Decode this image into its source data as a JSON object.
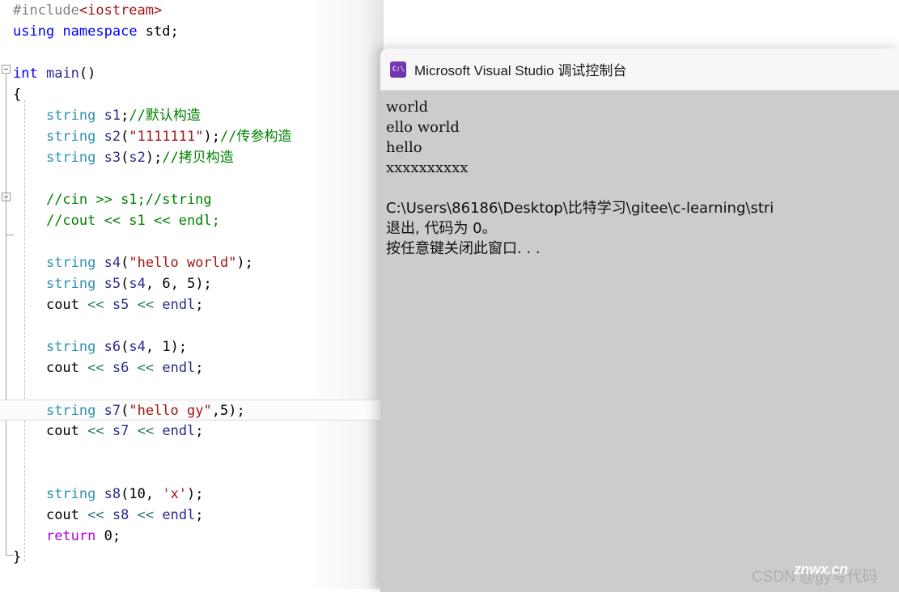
{
  "editor": {
    "name": "code-editor",
    "current_line_index": 19,
    "lines": [
      {
        "indent": 0,
        "tokens": [
          {
            "t": "pre",
            "v": "#include"
          },
          {
            "t": "inc",
            "v": "<iostream>"
          }
        ]
      },
      {
        "indent": 0,
        "tokens": [
          {
            "t": "key",
            "v": "using"
          },
          {
            "t": "plain",
            "v": " "
          },
          {
            "t": "key",
            "v": "namespace"
          },
          {
            "t": "plain",
            "v": " std;"
          }
        ]
      },
      {
        "indent": 0,
        "tokens": []
      },
      {
        "indent": 0,
        "tokens": [
          {
            "t": "key",
            "v": "int"
          },
          {
            "t": "plain",
            "v": " "
          },
          {
            "t": "ident",
            "v": "main"
          },
          {
            "t": "plain",
            "v": "()"
          }
        ]
      },
      {
        "indent": 0,
        "tokens": [
          {
            "t": "brace",
            "v": "{"
          }
        ]
      },
      {
        "indent": 1,
        "tokens": [
          {
            "t": "type",
            "v": "string"
          },
          {
            "t": "plain",
            "v": " "
          },
          {
            "t": "ident",
            "v": "s1"
          },
          {
            "t": "plain",
            "v": ";"
          },
          {
            "t": "cmt",
            "v": "//默认构造"
          }
        ]
      },
      {
        "indent": 1,
        "tokens": [
          {
            "t": "type",
            "v": "string"
          },
          {
            "t": "plain",
            "v": " "
          },
          {
            "t": "ident",
            "v": "s2"
          },
          {
            "t": "plain",
            "v": "("
          },
          {
            "t": "str",
            "v": "\"1111111\""
          },
          {
            "t": "plain",
            "v": ");"
          },
          {
            "t": "cmt",
            "v": "//传参构造"
          }
        ]
      },
      {
        "indent": 1,
        "tokens": [
          {
            "t": "type",
            "v": "string"
          },
          {
            "t": "plain",
            "v": " "
          },
          {
            "t": "ident",
            "v": "s3"
          },
          {
            "t": "plain",
            "v": "("
          },
          {
            "t": "ident",
            "v": "s2"
          },
          {
            "t": "plain",
            "v": ");"
          },
          {
            "t": "cmt",
            "v": "//拷贝构造"
          }
        ]
      },
      {
        "indent": 1,
        "tokens": []
      },
      {
        "indent": 1,
        "tokens": [
          {
            "t": "cmt",
            "v": "//cin >> s1;//string"
          }
        ]
      },
      {
        "indent": 1,
        "tokens": [
          {
            "t": "cmt",
            "v": "//cout << s1 << endl;"
          }
        ]
      },
      {
        "indent": 1,
        "tokens": []
      },
      {
        "indent": 1,
        "tokens": [
          {
            "t": "type",
            "v": "string"
          },
          {
            "t": "plain",
            "v": " "
          },
          {
            "t": "ident",
            "v": "s4"
          },
          {
            "t": "plain",
            "v": "("
          },
          {
            "t": "str",
            "v": "\"hello world\""
          },
          {
            "t": "plain",
            "v": ");"
          }
        ]
      },
      {
        "indent": 1,
        "tokens": [
          {
            "t": "type",
            "v": "string"
          },
          {
            "t": "plain",
            "v": " "
          },
          {
            "t": "ident",
            "v": "s5"
          },
          {
            "t": "plain",
            "v": "("
          },
          {
            "t": "ident",
            "v": "s4"
          },
          {
            "t": "plain",
            "v": ", "
          },
          {
            "t": "num",
            "v": "6"
          },
          {
            "t": "plain",
            "v": ", "
          },
          {
            "t": "num",
            "v": "5"
          },
          {
            "t": "plain",
            "v": ");"
          }
        ]
      },
      {
        "indent": 1,
        "tokens": [
          {
            "t": "plain",
            "v": "cout "
          },
          {
            "t": "op",
            "v": "<<"
          },
          {
            "t": "plain",
            "v": " "
          },
          {
            "t": "ident",
            "v": "s5"
          },
          {
            "t": "plain",
            "v": " "
          },
          {
            "t": "op",
            "v": "<<"
          },
          {
            "t": "plain",
            "v": " "
          },
          {
            "t": "ident",
            "v": "endl"
          },
          {
            "t": "plain",
            "v": ";"
          }
        ]
      },
      {
        "indent": 1,
        "tokens": []
      },
      {
        "indent": 1,
        "tokens": [
          {
            "t": "type",
            "v": "string"
          },
          {
            "t": "plain",
            "v": " "
          },
          {
            "t": "ident",
            "v": "s6"
          },
          {
            "t": "plain",
            "v": "("
          },
          {
            "t": "ident",
            "v": "s4"
          },
          {
            "t": "plain",
            "v": ", "
          },
          {
            "t": "num",
            "v": "1"
          },
          {
            "t": "plain",
            "v": ");"
          }
        ]
      },
      {
        "indent": 1,
        "tokens": [
          {
            "t": "plain",
            "v": "cout "
          },
          {
            "t": "op",
            "v": "<<"
          },
          {
            "t": "plain",
            "v": " "
          },
          {
            "t": "ident",
            "v": "s6"
          },
          {
            "t": "plain",
            "v": " "
          },
          {
            "t": "op",
            "v": "<<"
          },
          {
            "t": "plain",
            "v": " "
          },
          {
            "t": "ident",
            "v": "endl"
          },
          {
            "t": "plain",
            "v": ";"
          }
        ]
      },
      {
        "indent": 1,
        "tokens": []
      },
      {
        "indent": 1,
        "tokens": [
          {
            "t": "type",
            "v": "string"
          },
          {
            "t": "plain",
            "v": " "
          },
          {
            "t": "ident",
            "v": "s7"
          },
          {
            "t": "plain",
            "v": "("
          },
          {
            "t": "str",
            "v": "\"hello gy\""
          },
          {
            "t": "plain",
            "v": ","
          },
          {
            "t": "num",
            "v": "5"
          },
          {
            "t": "plain",
            "v": ");"
          }
        ]
      },
      {
        "indent": 1,
        "tokens": [
          {
            "t": "plain",
            "v": "cout "
          },
          {
            "t": "op",
            "v": "<<"
          },
          {
            "t": "plain",
            "v": " "
          },
          {
            "t": "ident",
            "v": "s7"
          },
          {
            "t": "plain",
            "v": " "
          },
          {
            "t": "op",
            "v": "<<"
          },
          {
            "t": "plain",
            "v": " "
          },
          {
            "t": "ident",
            "v": "endl"
          },
          {
            "t": "plain",
            "v": ";"
          }
        ]
      },
      {
        "indent": 1,
        "tokens": []
      },
      {
        "indent": 1,
        "tokens": []
      },
      {
        "indent": 1,
        "tokens": [
          {
            "t": "type",
            "v": "string"
          },
          {
            "t": "plain",
            "v": " "
          },
          {
            "t": "ident",
            "v": "s8"
          },
          {
            "t": "plain",
            "v": "("
          },
          {
            "t": "num",
            "v": "10"
          },
          {
            "t": "plain",
            "v": ", "
          },
          {
            "t": "str",
            "v": "'x'"
          },
          {
            "t": "plain",
            "v": ");"
          }
        ]
      },
      {
        "indent": 1,
        "tokens": [
          {
            "t": "plain",
            "v": "cout "
          },
          {
            "t": "op",
            "v": "<<"
          },
          {
            "t": "plain",
            "v": " "
          },
          {
            "t": "ident",
            "v": "s8"
          },
          {
            "t": "plain",
            "v": " "
          },
          {
            "t": "op",
            "v": "<<"
          },
          {
            "t": "plain",
            "v": " "
          },
          {
            "t": "ident",
            "v": "endl"
          },
          {
            "t": "plain",
            "v": ";"
          }
        ]
      },
      {
        "indent": 1,
        "tokens": [
          {
            "t": "kw2",
            "v": "return"
          },
          {
            "t": "plain",
            "v": " "
          },
          {
            "t": "num",
            "v": "0"
          },
          {
            "t": "plain",
            "v": ";"
          }
        ]
      },
      {
        "indent": 0,
        "tokens": [
          {
            "t": "brace",
            "v": "}"
          }
        ]
      }
    ]
  },
  "console": {
    "title": "Microsoft Visual Studio 调试控制台",
    "icon_glyph": "C:\\",
    "icon_name": "cmd-console-icon",
    "output": [
      "world",
      "ello world",
      "hello",
      "xxxxxxxxxx",
      "",
      "C:\\Users\\86186\\Desktop\\比特学习\\gitee\\c-learning\\stri",
      "退出, 代码为 0。",
      "按任意键关闭此窗口. . ."
    ]
  },
  "watermark": {
    "base": "CSDN @gy写代码",
    "overlay": "znwx.cn"
  },
  "colors": {
    "keyword": "#0000ff",
    "type": "#2b91af",
    "comment": "#008000",
    "string": "#a31515",
    "identifier": "#2b2b8f",
    "console_bg": "#cccccc",
    "console_titlebar": "#f7f7f7",
    "console_icon": "#6a2fa8"
  }
}
